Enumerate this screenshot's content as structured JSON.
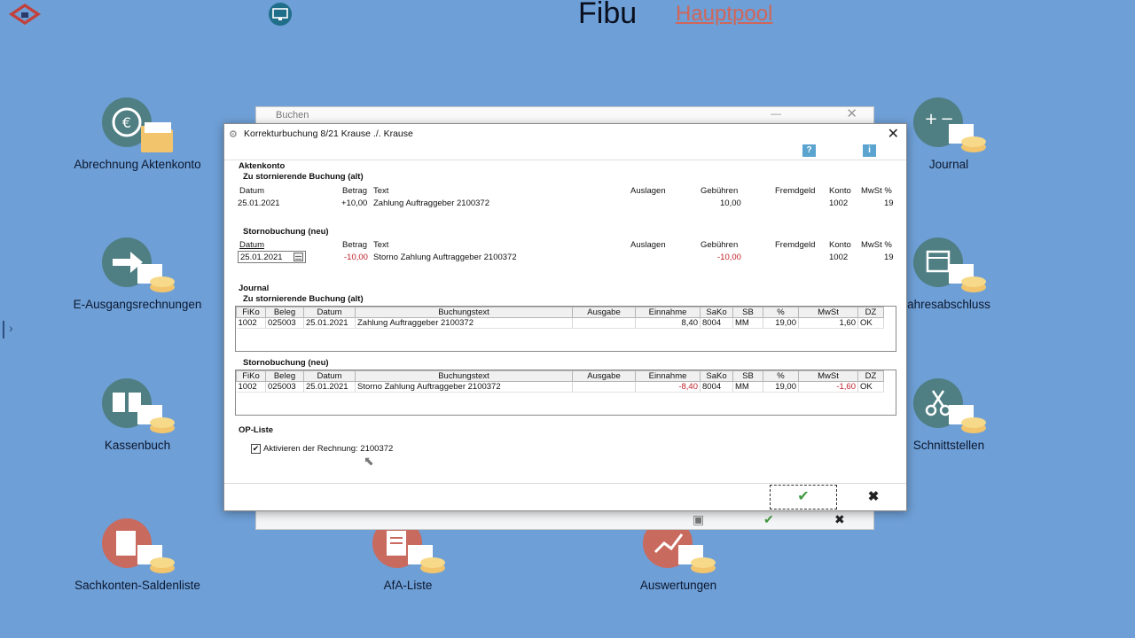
{
  "header": {
    "app_title": "Fibu",
    "pool_link": "Hauptpool"
  },
  "tiles": {
    "abrechnung": "Abrechnung Aktenkonto",
    "journal": "Journal",
    "e_ausgang": "E-Ausgangsrechnungen",
    "jahresabschluss": "ahresabschluss",
    "kassenbuch": "Kassenbuch",
    "schnittstellen": "Schnittstellen",
    "sachkonten": "Sachkonten-Saldenliste",
    "afa": "AfA-Liste",
    "auswertungen": "Auswertungen"
  },
  "background_window": {
    "title": "Buchen",
    "min_symbol": "—",
    "close_symbol": "✕",
    "footer_ok": "✔",
    "footer_cancel": "✖"
  },
  "dialog": {
    "title": "Korrekturbuchung 8/21 Krause ./. Krause",
    "help_label": "?",
    "info_label": "i",
    "close_symbol": "✕",
    "aktenkonto": {
      "heading": "Aktenkonto",
      "alt_heading": "Zu stornierende Buchung (alt)",
      "neu_heading": "Stornobuchung (neu)",
      "col_datum": "Datum",
      "col_betrag": "Betrag",
      "col_text": "Text",
      "col_auslagen": "Auslagen",
      "col_gebuehren": "Gebühren",
      "col_fremdgeld": "Fremdgeld",
      "col_konto": "Konto",
      "col_mwst": "MwSt %",
      "alt_row": {
        "datum": "25.01.2021",
        "betrag": "+10,00",
        "text": "Zahlung Auftraggeber 2100372",
        "gebuehren": "10,00",
        "konto": "1002",
        "mwst": "19"
      },
      "neu_row": {
        "datum": "25.01.2021",
        "betrag": "-10,00",
        "text": "Storno Zahlung Auftraggeber 2100372",
        "gebuehren": "-10,00",
        "konto": "1002",
        "mwst": "19"
      }
    },
    "journal": {
      "heading": "Journal",
      "alt_heading": "Zu stornierende Buchung (alt)",
      "neu_heading": "Stornobuchung (neu)",
      "columns": [
        "FiKo",
        "Beleg",
        "Datum",
        "Buchungstext",
        "Ausgabe",
        "Einnahme",
        "SaKo",
        "SB",
        "%",
        "MwSt",
        "DZ"
      ],
      "alt_row": {
        "fiko": "1002",
        "beleg": "025003",
        "datum": "25.01.2021",
        "text": "Zahlung Auftraggeber 2100372",
        "ausgabe": "",
        "einnahme": "8,40",
        "sako": "8004",
        "sb": "MM",
        "pct": "19,00",
        "mwst": "1,60",
        "dz": "OK"
      },
      "neu_row": {
        "fiko": "1002",
        "beleg": "025003",
        "datum": "25.01.2021",
        "text": "Storno Zahlung Auftraggeber 2100372",
        "ausgabe": "",
        "einnahme": "-8,40",
        "sako": "8004",
        "sb": "MM",
        "pct": "19,00",
        "mwst": "-1,60",
        "dz": "OK"
      }
    },
    "op_liste": {
      "heading": "OP-Liste",
      "checkbox_label": "Aktivieren der Rechnung: 2100372",
      "check_mark": "✔"
    },
    "footer": {
      "ok_symbol": "✔",
      "cancel_symbol": "✖"
    }
  },
  "colors": {
    "desktop_bg": "#6e9fd6",
    "accent_link": "#d0665a",
    "negative": "#c0202a",
    "ok_green": "#3f9a3f"
  },
  "icons": [
    "home-icon",
    "screen-icon",
    "euro-icon",
    "folder-icon",
    "calculator-icon",
    "coins-icon",
    "arrow-right-icon",
    "book-icon",
    "scissors-icon",
    "document-icon",
    "chart-icon",
    "calendar-icon",
    "checkmark-icon",
    "close-icon",
    "help-icon",
    "info-icon"
  ]
}
